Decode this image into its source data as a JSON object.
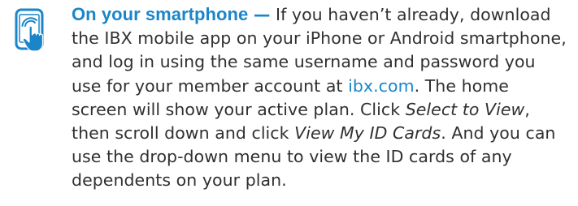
{
  "icon": {
    "name": "smartphone-tap-icon",
    "color": "#1a86c9"
  },
  "section": {
    "heading": "On your smartphone",
    "dash": "—",
    "text_1": " If you haven’t already, download the IBX mobile app on your iPhone or Android smartphone, and log in using the same username and password you use for your member account at ",
    "link_text": "ibx.com",
    "text_2": ". The home screen will show your active plan. Click ",
    "em_1": "Select to View",
    "text_3": ", then scroll down and click ",
    "em_2": "View My ID Cards",
    "text_4": ". And you can use the drop-down menu to view the ID cards of any dependents on your plan."
  },
  "colors": {
    "accent": "#1a86c9",
    "body_text": "#303030"
  }
}
